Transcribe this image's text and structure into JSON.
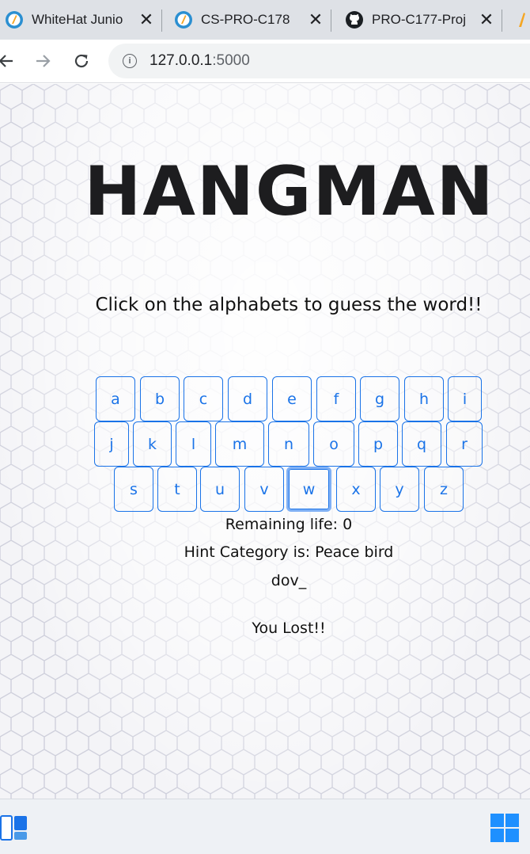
{
  "browser": {
    "tabs": [
      {
        "title": "WhiteHat Junio",
        "icon": "whitehat-logo-icon"
      },
      {
        "title": "CS-PRO-C178",
        "icon": "whitehat-logo-icon"
      },
      {
        "title": "PRO-C177-Proj",
        "icon": "github-logo-icon"
      }
    ],
    "address": {
      "host": "127.0.0.1",
      "port": ":5000"
    }
  },
  "game": {
    "title": "HANGMAN",
    "instruction": "Click on the alphabets to guess the word!!",
    "keyboard": {
      "row1": [
        "a",
        "b",
        "c",
        "d",
        "e",
        "f",
        "g",
        "h",
        "i"
      ],
      "row2": [
        "j",
        "k",
        "l",
        "m",
        "n",
        "o",
        "p",
        "q",
        "r"
      ],
      "row3": [
        "s",
        "t",
        "u",
        "v",
        "w",
        "x",
        "y",
        "z"
      ],
      "focused_key": "w"
    },
    "remaining_life": "Remaining life: 0",
    "hint": "Hint Category is: Peace bird",
    "word_progress": "dov_",
    "result": "You Lost!!"
  },
  "colors": {
    "key_accent": "#1a73e8",
    "chrome_tabbar": "#dee1e6"
  }
}
